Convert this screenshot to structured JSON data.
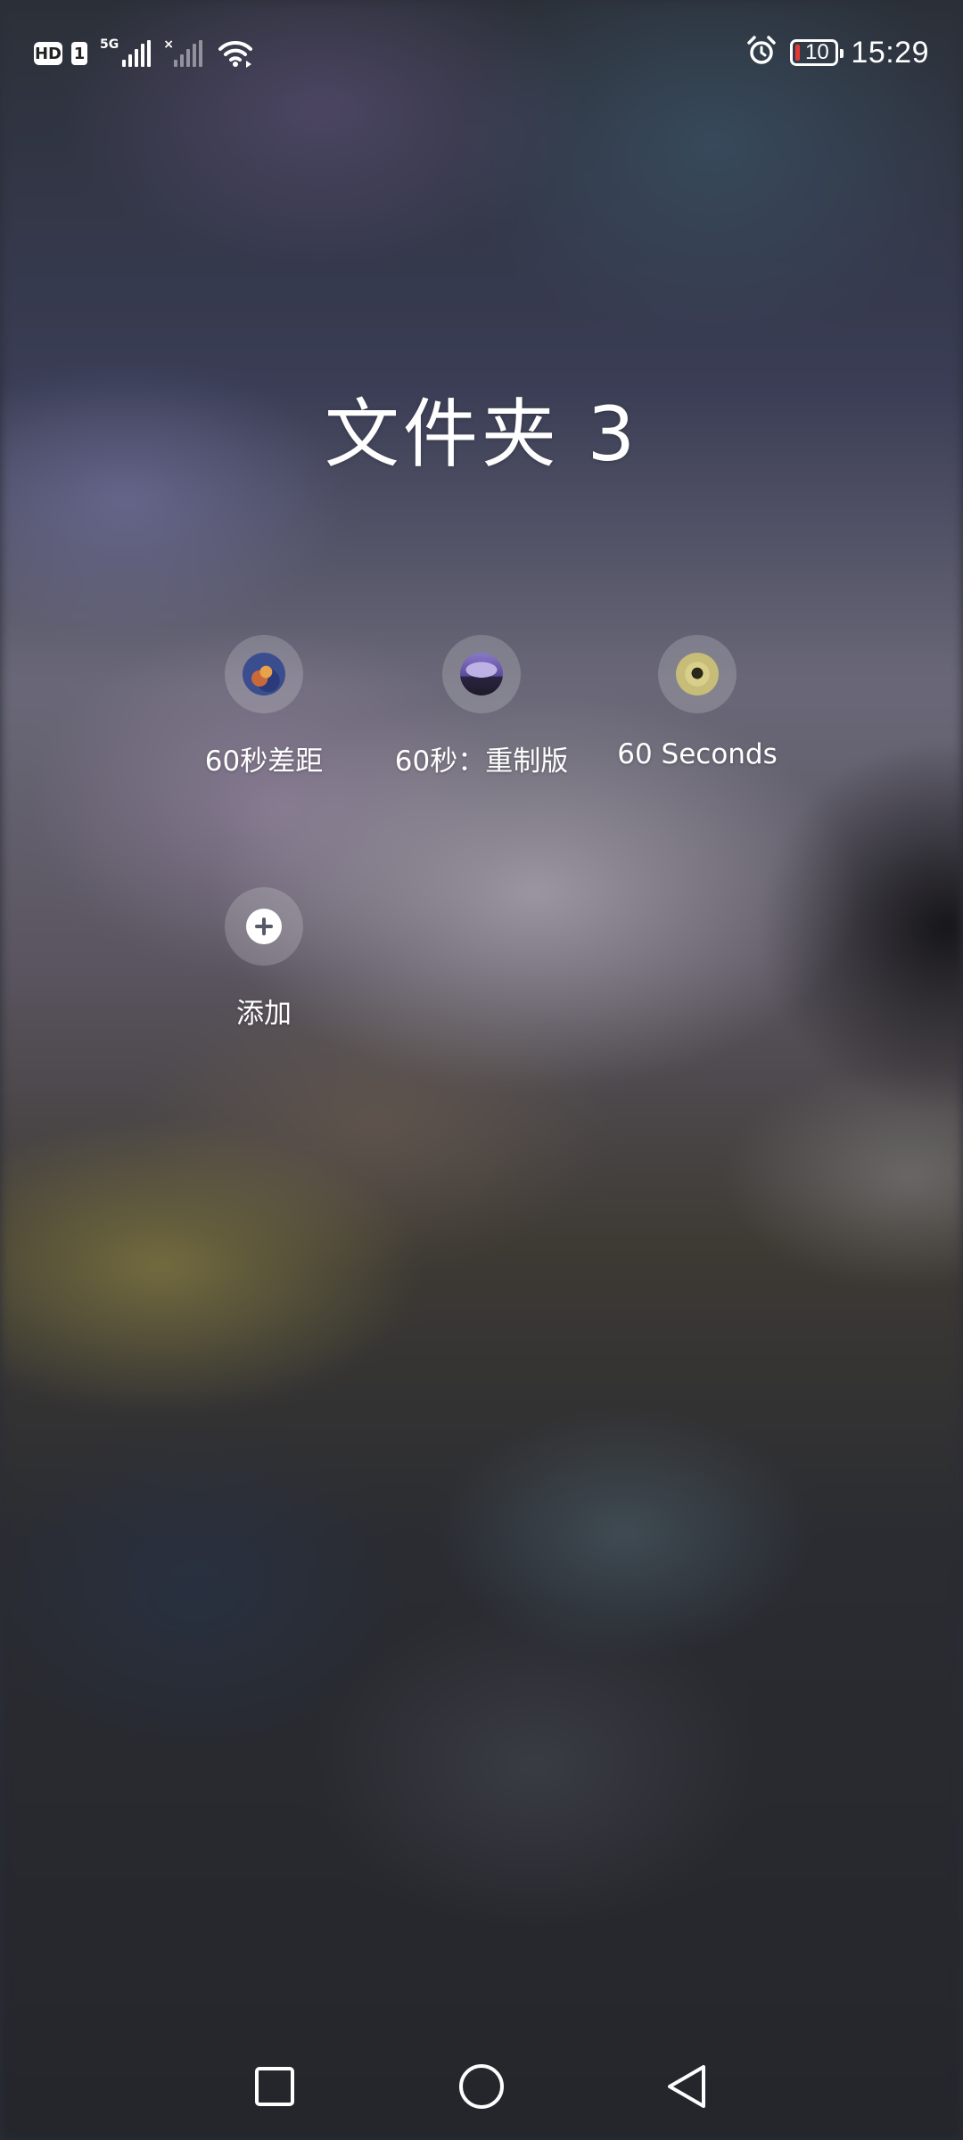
{
  "status_bar": {
    "hd_label": "HD",
    "sim_label": "1",
    "network_type": "5G",
    "signal2_mark": "×",
    "battery_level": "10",
    "time": "15:29",
    "icons": [
      "hd-icon",
      "sim-1-icon",
      "signal-5g-icon",
      "signal-no-service-icon",
      "wifi-icon",
      "alarm-icon",
      "battery-icon"
    ]
  },
  "folder": {
    "title": "文件夹 3",
    "apps": [
      {
        "label": "60秒差距",
        "icon": "app-60s-gap-icon"
      },
      {
        "label": "60秒：重制版",
        "icon": "app-60s-remake-icon"
      },
      {
        "label": "60 Seconds",
        "icon": "app-60-seconds-icon"
      }
    ],
    "add": {
      "label": "添加",
      "icon": "plus-icon"
    }
  },
  "nav_bar": {
    "buttons": [
      "recent-apps",
      "home",
      "back"
    ]
  },
  "colors": {
    "battery_low": "#e53935",
    "text": "#ffffff"
  }
}
